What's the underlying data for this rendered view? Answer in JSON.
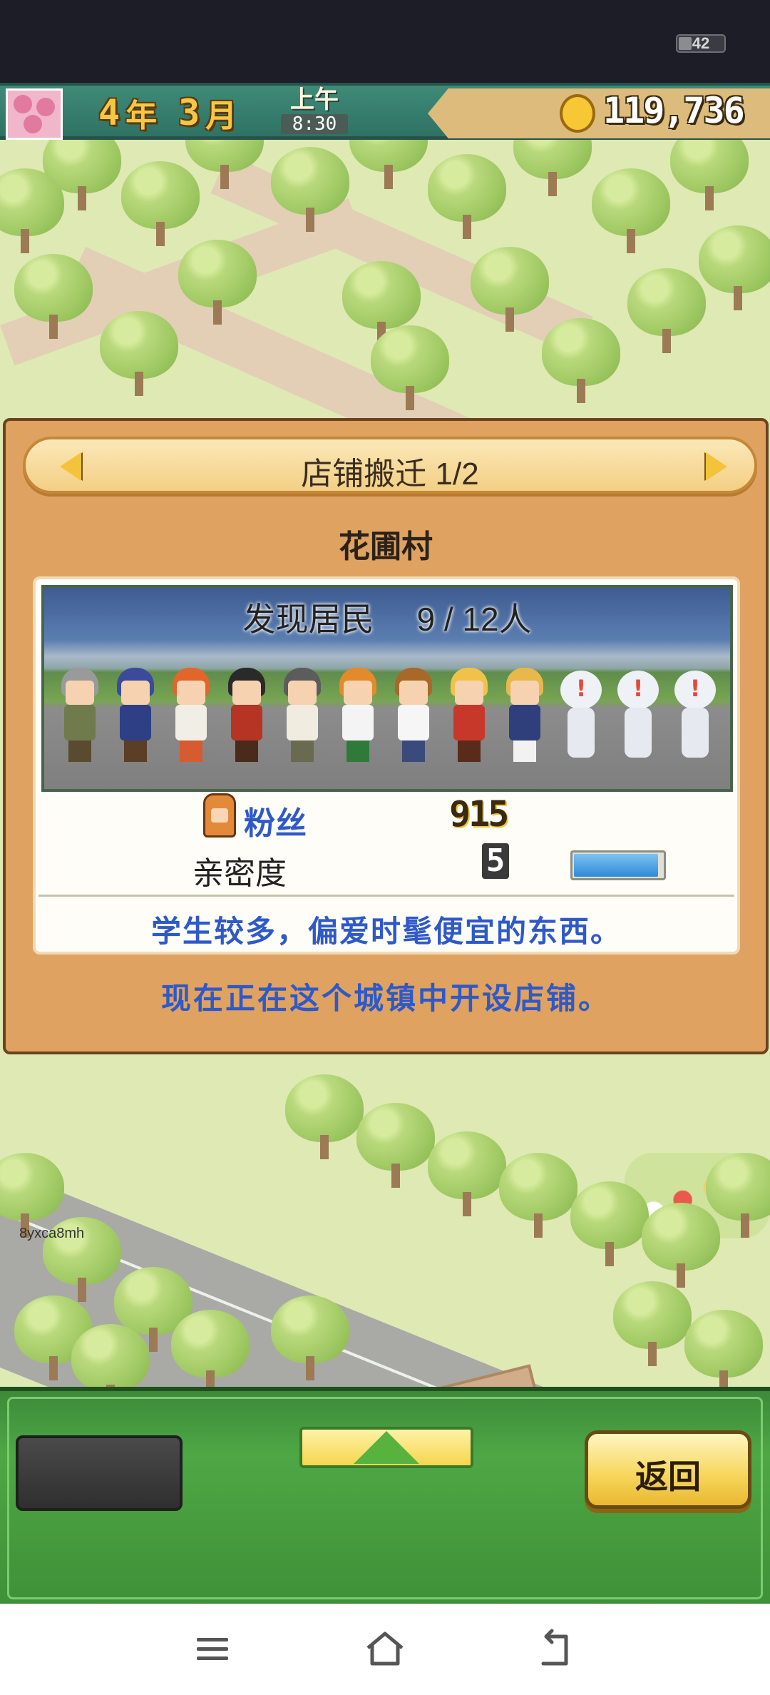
{
  "status_bar": {
    "battery_level": "42"
  },
  "hud": {
    "year_value": "4",
    "year_unit": "年",
    "month_value": "3",
    "month_unit": "月",
    "period": "上午",
    "time": "8:30",
    "money": "119,736"
  },
  "dialog": {
    "title": "店铺搬迁 1/2",
    "town_name": "花圃村",
    "residents_label": "发现居民",
    "residents_count": "9 / 12人",
    "fans_label": "粉丝",
    "fans_value": "915",
    "affinity_label": "亲密度",
    "affinity_value": "5",
    "affinity_bar_level": 0.95,
    "description": "学生较多，偏爱时髦便宜的东西。",
    "status_message": "现在正在这个城镇中开设店铺。"
  },
  "watermark": "8yxca8mh",
  "bottom_menu": {
    "back_label": "返回"
  },
  "colors": {
    "accent_blue": "#2e59c8",
    "dialog_bg": "#dfa260",
    "menu_green": "#4ea744"
  }
}
